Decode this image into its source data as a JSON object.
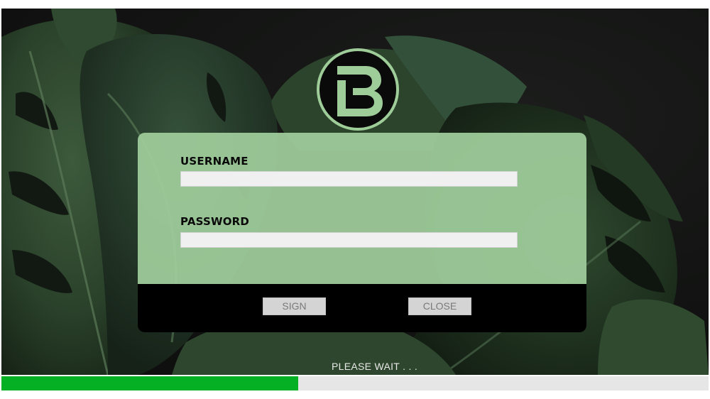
{
  "app": {
    "logo_icon": "letter-b-logo-icon",
    "accent_color": "#9fcd99",
    "progress_color": "#06b025"
  },
  "login": {
    "username_label": "USERNAME",
    "username_value": "",
    "password_label": "PASSWORD",
    "password_value": ""
  },
  "buttons": {
    "sign_label": "SIGN",
    "close_label": "CLOSE"
  },
  "status": {
    "text": "PLEASE WAIT . . .",
    "progress_fraction": 0.42
  }
}
